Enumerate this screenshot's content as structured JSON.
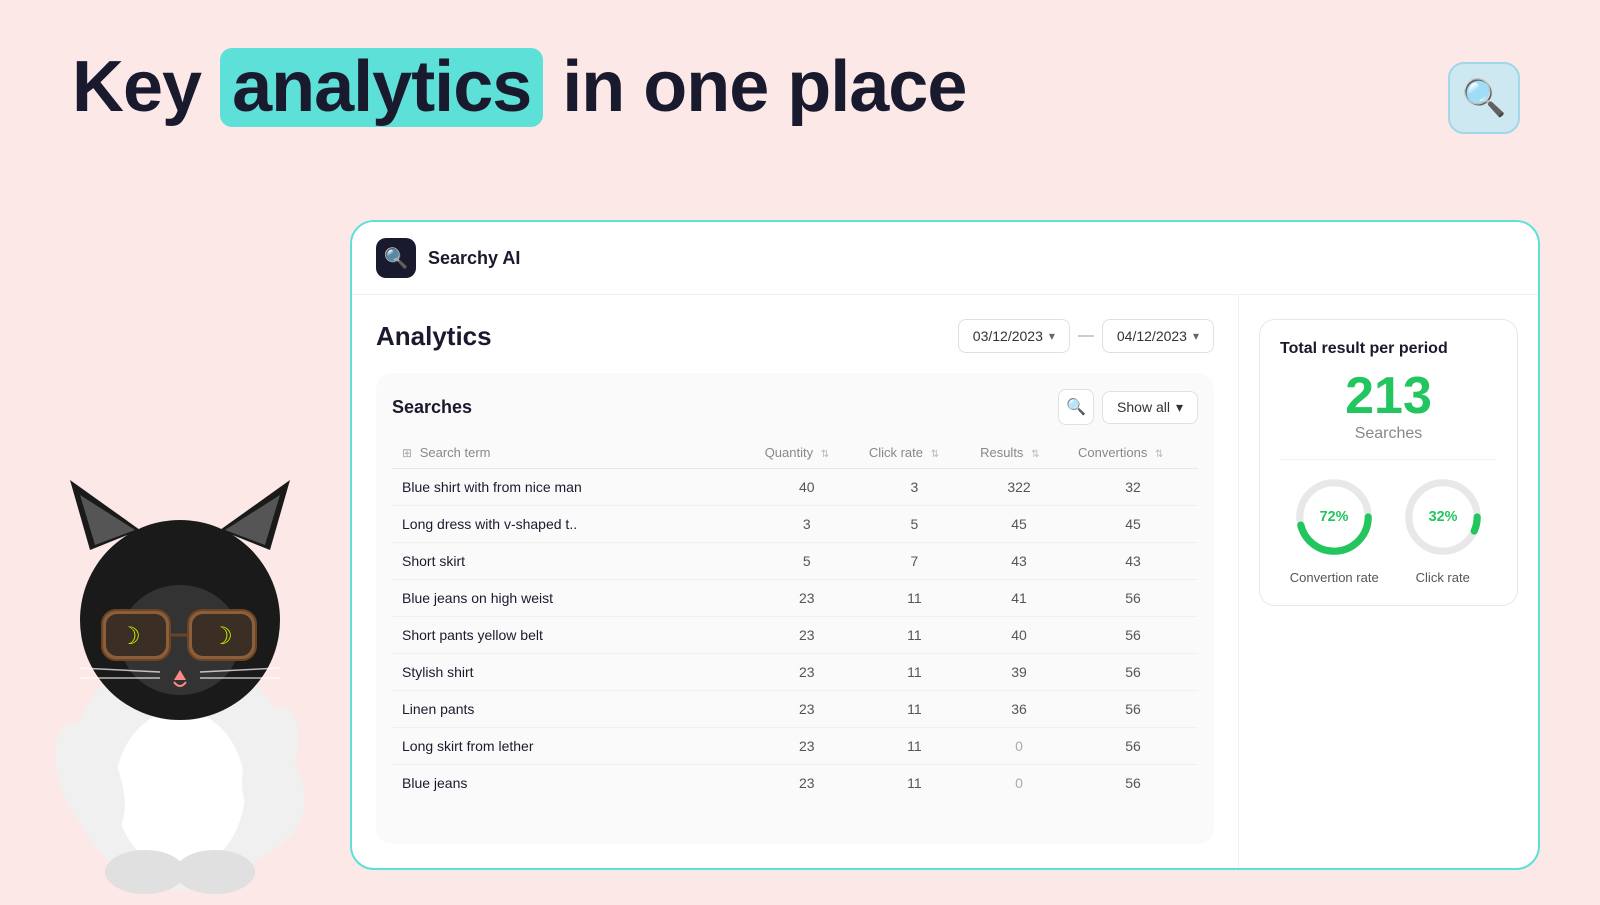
{
  "hero": {
    "title_before": "Key ",
    "title_highlight": "analytics",
    "title_after": " in one place"
  },
  "topbar": {
    "app_name": "Searchy AI",
    "logo_icon": "🔍"
  },
  "analytics": {
    "title": "Analytics",
    "date_from": "03/12/2023",
    "date_to": "04/12/2023",
    "section_title": "Searches",
    "show_all_label": "Show all",
    "columns": {
      "search_term": "Search term",
      "quantity": "Quantity",
      "click_rate": "Click rate",
      "results": "Results",
      "conversions": "Convertions"
    },
    "rows": [
      {
        "term": "Blue shirt with from nice man",
        "quantity": 40,
        "click_rate": 3,
        "results": 322,
        "conversions": 32
      },
      {
        "term": "Long dress with v-shaped t..",
        "quantity": 3,
        "click_rate": 5,
        "results": 45,
        "conversions": 45
      },
      {
        "term": "Short skirt",
        "quantity": 5,
        "click_rate": 7,
        "results": 43,
        "conversions": 43
      },
      {
        "term": "Blue jeans on high weist",
        "quantity": 23,
        "click_rate": 11,
        "results": 41,
        "conversions": 56
      },
      {
        "term": "Short pants yellow belt",
        "quantity": 23,
        "click_rate": 11,
        "results": 40,
        "conversions": 56
      },
      {
        "term": "Stylish shirt",
        "quantity": 23,
        "click_rate": 11,
        "results": 39,
        "conversions": 56
      },
      {
        "term": "Linen pants",
        "quantity": 23,
        "click_rate": 11,
        "results": 36,
        "conversions": 56
      },
      {
        "term": "Long skirt from lether",
        "quantity": 23,
        "click_rate": 11,
        "results": 0,
        "conversions": 56
      },
      {
        "term": "Blue jeans",
        "quantity": 23,
        "click_rate": 11,
        "results": 0,
        "conversions": 56
      }
    ]
  },
  "stats": {
    "card_title": "Total result per period",
    "total_number": "213",
    "total_label": "Searches",
    "conversion_rate": 72,
    "conversion_label": "Convertion rate",
    "click_rate": 32,
    "click_label": "Click rate"
  }
}
